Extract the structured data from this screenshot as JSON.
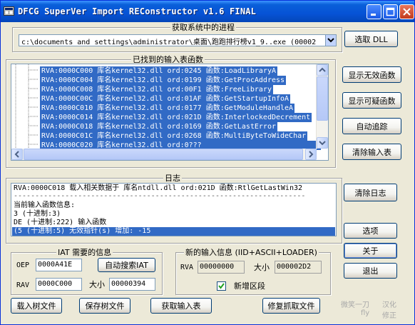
{
  "window": {
    "title": "DFCG SuperVer Import REConstructor v1.6 FINAL",
    "accent": "#0653d6"
  },
  "process": {
    "group_title": "获取系统中的进程",
    "selected": "c:\\documents and settings\\administrator\\桌面\\跑跑排行榜v1_9..exe (00002",
    "pick_dll_label": "选取 DLL"
  },
  "imports": {
    "group_title": "已找到的输入表函数",
    "rows": [
      "RVA:0000C000 库名kernel32.dll ord:0245 函数:LoadLibraryA",
      "RVA:0000C004 库名kernel32.dll ord:0199 函数:GetProcAddress",
      "RVA:0000C008 库名kernel32.dll ord:00F1 函数:FreeLibrary",
      "RVA:0000C00C 库名kernel32.dll ord:01AF 函数:GetStartupInfoA",
      "RVA:0000C010 库名kernel32.dll ord:0177 函数:GetModuleHandleA",
      "RVA:0000C014 库名kernel32.dll ord:021D 函数:InterlockedDecrement",
      "RVA:0000C018 库名kernel32.dll ord:0169 函数:GetLastError",
      "RVA:0000C01C 库名kernel32.dll ord:0268 函数:MultiByteToWideChar"
    ],
    "partial_row": "RVA:0000C020 库名kernel32.dll ord:0???"
  },
  "side_buttons": {
    "show_invalid": "显示无效函数",
    "show_suspect": "显示可疑函数",
    "auto_trace": "自动追踪",
    "clear_imports": "清除输入表",
    "clear_log": "清除日志",
    "options": "选项",
    "about": "关于",
    "exit": "退出"
  },
  "log": {
    "group_title": "日志",
    "lines": [
      "RVA:0000C018 载入相关数据于 库名ntdll.dll ord:021D 函数:RtlGetLastWin32",
      "--------------------------------------------------------------------",
      "当前输入函数信息:",
      "3 (十进制:3)",
      "DE (十进制:222) 输入函数",
      "(5 (十进制:5) 无效指针(s) 增加: -15"
    ]
  },
  "iat": {
    "group_title": "IAT 需要的信息",
    "oep_label": "OEP",
    "oep_value": "0000A41E",
    "auto_search_label": "自动搜索IAT",
    "rva_label": "RAV",
    "rva_value": "0000C000",
    "size_label": "大小",
    "size_value": "00000394"
  },
  "new_import": {
    "group_title": "新的输入信息 (IID+ASCII+LOADER)",
    "rva_label": "RVA",
    "rva_value": "00000000",
    "size_label": "大小",
    "size_value": "000002D2",
    "new_section_label": "新增区段",
    "new_section_checked": true
  },
  "bottom_buttons": {
    "load_tree": "载入树文件",
    "save_tree": "保存树文件",
    "get_imports": "获取输入表",
    "fix_dump": "修复抓取文件"
  },
  "credits": {
    "line1_left": "微笑一刀",
    "line1_right": "汉化",
    "line2_left": "fly",
    "line2_right": "修正"
  }
}
